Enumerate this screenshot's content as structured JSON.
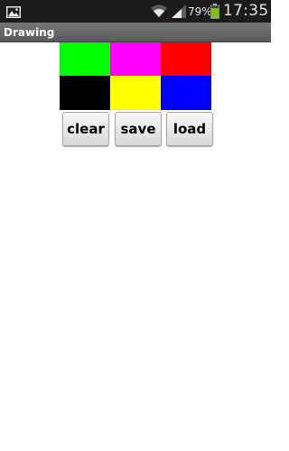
{
  "status_bar": {
    "battery_percent": "79%",
    "time": "17:35",
    "battery_level": 0.79,
    "battery_color": "#7bc300",
    "icons": [
      "image-notification-icon",
      "wifi-icon",
      "signal-icon",
      "battery-icon"
    ]
  },
  "app": {
    "title": "Drawing"
  },
  "palette": {
    "colors": [
      {
        "name": "green",
        "hex": "#00ff00"
      },
      {
        "name": "magenta",
        "hex": "#ff00ff"
      },
      {
        "name": "red",
        "hex": "#ff0000"
      },
      {
        "name": "black",
        "hex": "#000000"
      },
      {
        "name": "yellow",
        "hex": "#ffff00"
      },
      {
        "name": "blue",
        "hex": "#0000ff"
      }
    ]
  },
  "buttons": {
    "clear_label": "clear",
    "save_label": "save",
    "load_label": "load"
  }
}
